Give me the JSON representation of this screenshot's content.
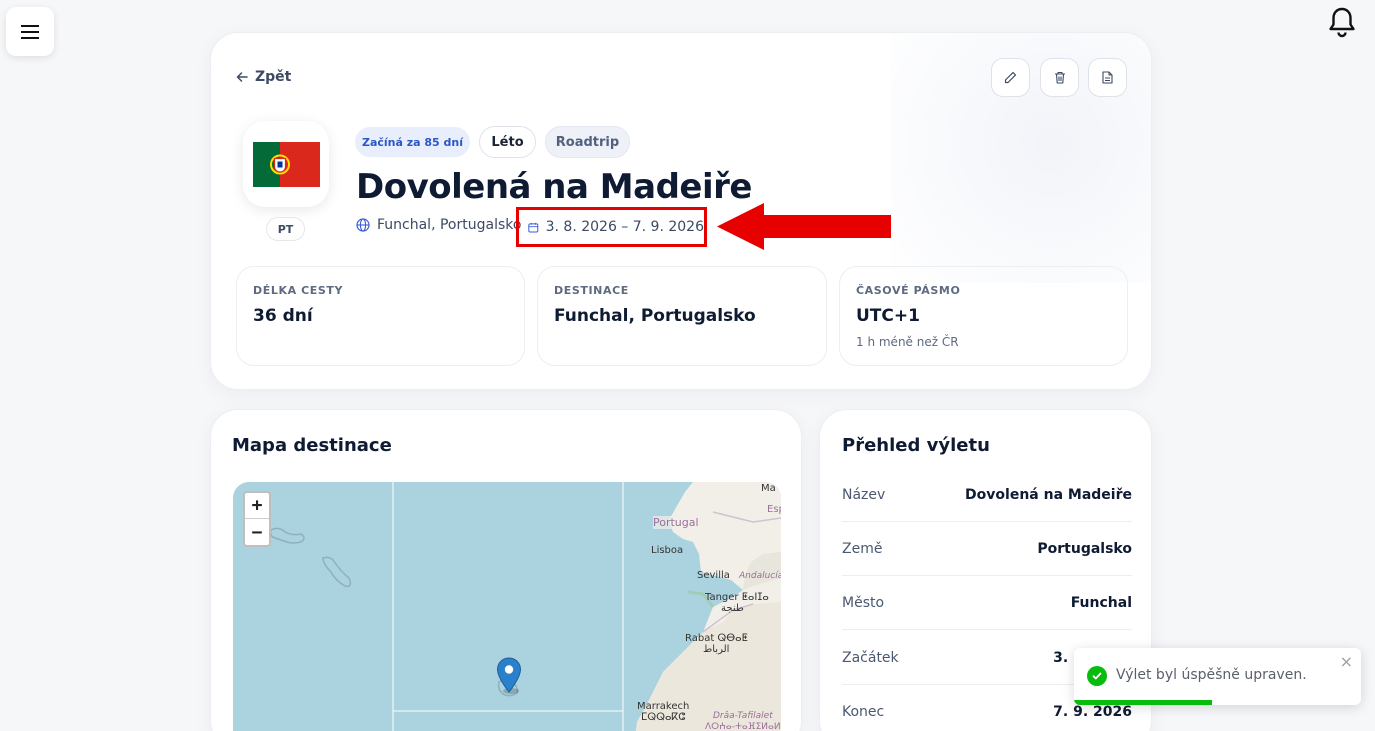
{
  "hero": {
    "back_label": "Zpět",
    "tags": {
      "start": "Začíná za 85 dní",
      "season": "Léto",
      "type": "Roadtrip"
    },
    "country_code": "PT",
    "title": "Dovolená na Madeiře",
    "location": "Funchal, Portugalsko",
    "dates": "3. 8. 2026 – 7. 9. 2026"
  },
  "stats": [
    {
      "label": "Délka cesty",
      "value": "36 dní",
      "sub": ""
    },
    {
      "label": "Destinace",
      "value": "Funchal, Portugalsko",
      "sub": ""
    },
    {
      "label": "Časové pásmo",
      "value": "UTC+1",
      "sub": "1 h méně než ČR"
    }
  ],
  "map": {
    "title": "Mapa destinace",
    "zoom_in": "+",
    "zoom_out": "−",
    "labels": {
      "portugal": "Portugal",
      "lisboa": "Lisboa",
      "sevilla": "Sevilla",
      "andalucia": "Andalucía",
      "tanger": "Tanger ⵟⴰⵏⵊⴰ",
      "tanger_ar": "طنجة",
      "rabat": "Rabat ⵕⴱⴰⵟ",
      "rabat_ar": "الرباط",
      "marrakech": "Marrakech",
      "marrakech_tif": "ⵎⵕⵕⴰⴽⵛ",
      "draa": "Drâa-Tafilalet",
      "draa_tif": "ⴷⵔⵄⴰ-ⵜⴰⴼⵉⵍⴰⵍⵜ",
      "es_partial": "Esp",
      "ma_partial": "Ma"
    }
  },
  "overview": {
    "title": "Přehled výletu",
    "rows": [
      {
        "key": "Název",
        "value": "Dovolená na Madeiře"
      },
      {
        "key": "Země",
        "value": "Portugalsko"
      },
      {
        "key": "Město",
        "value": "Funchal"
      },
      {
        "key": "Začátek",
        "value": "3. 8. 2026"
      },
      {
        "key": "Konec",
        "value": "7. 9. 2026"
      }
    ]
  },
  "toast": {
    "message": "Výlet byl úspěšně upraven.",
    "close": "×",
    "progress": 0.48
  },
  "colors": {
    "annotation_red": "#e60000",
    "success_green": "#07bc0c",
    "accent_blue": "#2b57c7"
  },
  "icons": [
    "menu-icon",
    "bell-icon",
    "arrow-left-icon",
    "pencil-icon",
    "trash-icon",
    "document-icon",
    "globe-icon",
    "calendar-icon",
    "map-pin-icon",
    "check-icon",
    "close-icon"
  ]
}
